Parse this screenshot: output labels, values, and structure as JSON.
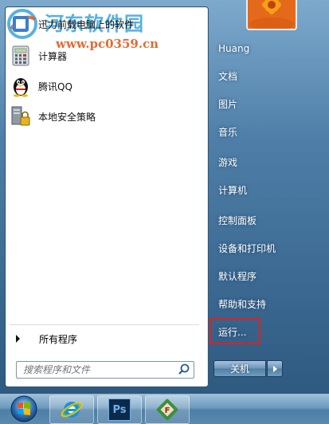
{
  "watermark": {
    "title": "河东软件园",
    "url": "www.pc0359.cn"
  },
  "pinned_programs": [
    {
      "label": "迅力前载电脑上的软件",
      "icon": "app-icon"
    },
    {
      "label": "计算器",
      "icon": "calculator-icon"
    },
    {
      "label": "腾讯QQ",
      "icon": "qq-penguin-icon"
    },
    {
      "label": "本地安全策略",
      "icon": "security-policy-icon"
    }
  ],
  "all_programs_label": "所有程序",
  "search": {
    "placeholder": "搜索程序和文件"
  },
  "user_name": "Huang",
  "right_items": [
    {
      "label": "文档"
    },
    {
      "label": "图片"
    },
    {
      "label": "音乐"
    },
    {
      "label": "游戏"
    },
    {
      "label": "计算机"
    },
    {
      "label": "控制面板"
    },
    {
      "label": "设备和打印机"
    },
    {
      "label": "默认程序"
    },
    {
      "label": "帮助和支持"
    },
    {
      "label": "运行..."
    }
  ],
  "shutdown_label": "关机",
  "taskbar": {
    "items": [
      {
        "icon": "internet-explorer-icon"
      },
      {
        "icon": "photoshop-icon",
        "text": "Ps"
      },
      {
        "icon": "archive-tool-icon"
      }
    ]
  },
  "colors": {
    "highlight_box": "#e02020",
    "frame": "#4f7fa8"
  }
}
